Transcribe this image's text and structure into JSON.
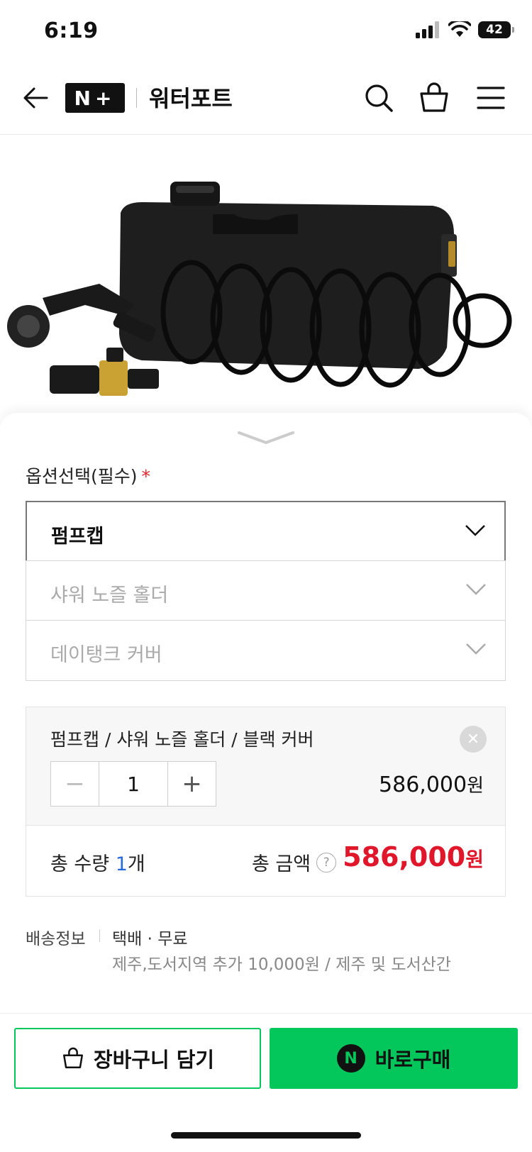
{
  "status_bar": {
    "time": "6:19",
    "battery": "42"
  },
  "header": {
    "logo": "N+",
    "title": "워터포트"
  },
  "options": {
    "label": "옵션선택(필수)",
    "required_mark": "*",
    "selects": [
      {
        "value": "펌프캡",
        "state": "active"
      },
      {
        "value": "샤워 노즐 홀더",
        "state": "disabled"
      },
      {
        "value": "데이탱크 커버",
        "state": "disabled"
      }
    ]
  },
  "selected_item": {
    "name": "펌프캡 / 샤워 노즐 홀더 / 블랙 커버",
    "quantity": "1",
    "price": "586,000",
    "currency": "원",
    "minus": "−",
    "plus": "+"
  },
  "total": {
    "qty_prefix": "총 수량",
    "qty_value": "1",
    "qty_suffix": "개",
    "amount_label": "총 금액",
    "help": "?",
    "amount": "586,000",
    "currency": "원"
  },
  "shipping": {
    "label": "배송정보",
    "method": "택배 · 무료",
    "note": "제주,도서지역 추가 10,000원 / 제주 및 도서산간"
  },
  "buttons": {
    "cart": "장바구니 담기",
    "buy": "바로구매",
    "buy_badge": "N"
  },
  "colors": {
    "accent_green": "#03c75a",
    "price_red": "#e0162b",
    "qty_blue": "#2a6ae0"
  }
}
